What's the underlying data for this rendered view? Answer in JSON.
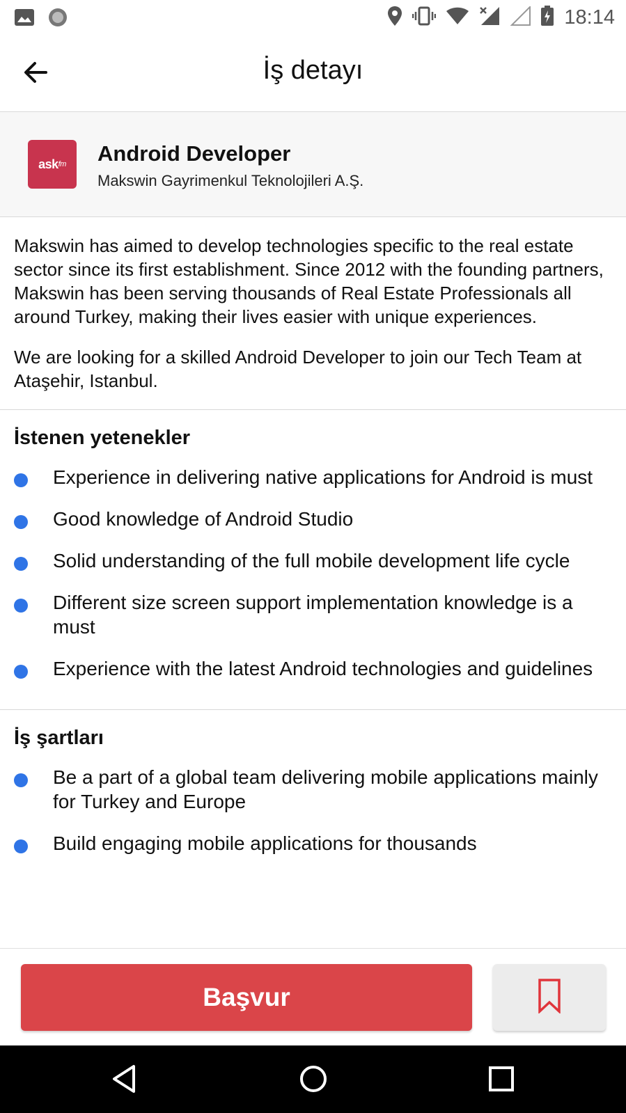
{
  "status_bar": {
    "time": "18:14",
    "icons": [
      "image-icon",
      "record-icon",
      "location-icon",
      "vibrate-icon",
      "wifi-icon",
      "signal-x-icon",
      "signal-icon",
      "battery-icon"
    ]
  },
  "app_bar": {
    "title": "İş detayı",
    "back_icon": "arrow-back-icon"
  },
  "job": {
    "logo_text": "ask",
    "logo_suffix": "fm",
    "logo_color": "#c8344e",
    "title": "Android Developer",
    "company": "Makswin Gayrimenkul Teknolojileri A.Ş."
  },
  "description": {
    "paragraphs": [
      "Makswin has aimed to develop technologies specific to the real estate sector since its first establishment. Since 2012 with the founding partners, Makswin has been serving thousands of Real Estate Professionals all around Turkey, making their lives easier with unique experiences.",
      "We are looking for a skilled Android Developer to join our Tech Team at Ataşehir, Istanbul."
    ]
  },
  "skills": {
    "heading": "İstenen yetenekler",
    "items": [
      "Experience in delivering native applications for Android is must",
      "Good knowledge of Android Studio",
      "Solid understanding of the full mobile development life cycle",
      "Different size screen support implementation knowledge is a must",
      "Experience with the latest Android technologies and guidelines"
    ]
  },
  "conditions": {
    "heading": "İş şartları",
    "items": [
      "Be a part of a global team delivering mobile applications mainly for Turkey and Europe",
      "Build engaging mobile applications for thousands"
    ]
  },
  "actions": {
    "apply_label": "Başvur",
    "apply_color": "#da4549",
    "bookmark_icon": "bookmark-icon"
  },
  "nav_bar": {
    "icons": [
      "nav-back-icon",
      "nav-home-icon",
      "nav-recents-icon"
    ]
  },
  "colors": {
    "bullet": "#2f74e6"
  }
}
